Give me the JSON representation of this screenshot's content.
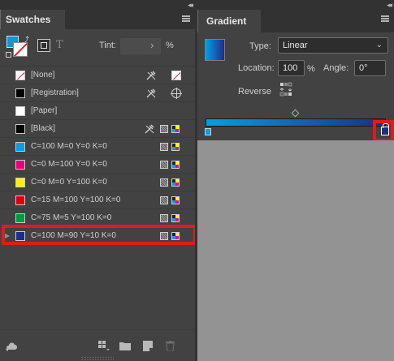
{
  "swatches_panel": {
    "collapse_glyph": "◂◂",
    "tab_title": "Swatches",
    "tint_label": "Tint:",
    "tint_value": "",
    "tint_arrow": "›",
    "tint_unit": "%",
    "text_button_glyph": "T",
    "swatches": [
      {
        "name": "[None]",
        "color": "none",
        "icons": [
          "locked",
          "none"
        ]
      },
      {
        "name": "[Registration]",
        "color": "#000000",
        "icons": [
          "locked",
          "registration"
        ]
      },
      {
        "name": "[Paper]",
        "color": "#ffffff",
        "icons": []
      },
      {
        "name": "[Black]",
        "color": "#000000",
        "icons": [
          "locked",
          "process",
          "cmyk"
        ]
      },
      {
        "name": "C=100 M=0 Y=0 K=0",
        "color": "#00a0e9",
        "icons": [
          "process",
          "cmyk"
        ]
      },
      {
        "name": "C=0 M=100 Y=0 K=0",
        "color": "#e4007f",
        "icons": [
          "process",
          "cmyk"
        ]
      },
      {
        "name": "C=0 M=0 Y=100 K=0",
        "color": "#fff100",
        "icons": [
          "process",
          "cmyk"
        ]
      },
      {
        "name": "C=15 M=100 Y=100 K=0",
        "color": "#d7000f",
        "icons": [
          "process",
          "cmyk"
        ]
      },
      {
        "name": "C=75 M=5 Y=100 K=0",
        "color": "#009a3e",
        "icons": [
          "process",
          "cmyk"
        ]
      },
      {
        "name": "C=100 M=90 Y=10 K=0",
        "color": "#1d2e89",
        "icons": [
          "process",
          "cmyk"
        ],
        "selected": true
      }
    ],
    "footer_icons": [
      "cc-libraries-icon",
      "swatch-views-icon",
      "new-color-group-icon",
      "new-swatch-icon",
      "delete-swatch-icon"
    ]
  },
  "gradient_panel": {
    "collapse_glyph": "◂◂",
    "tab_title": "Gradient",
    "type_label": "Type:",
    "type_value": "Linear",
    "location_label": "Location:",
    "location_value": "100",
    "location_unit": "%",
    "angle_label": "Angle:",
    "angle_value": "0°",
    "reverse_label": "Reverse",
    "start_color": "#00a0e9",
    "end_color": "#1d2e89"
  },
  "highlight_color": "#e11b1b"
}
